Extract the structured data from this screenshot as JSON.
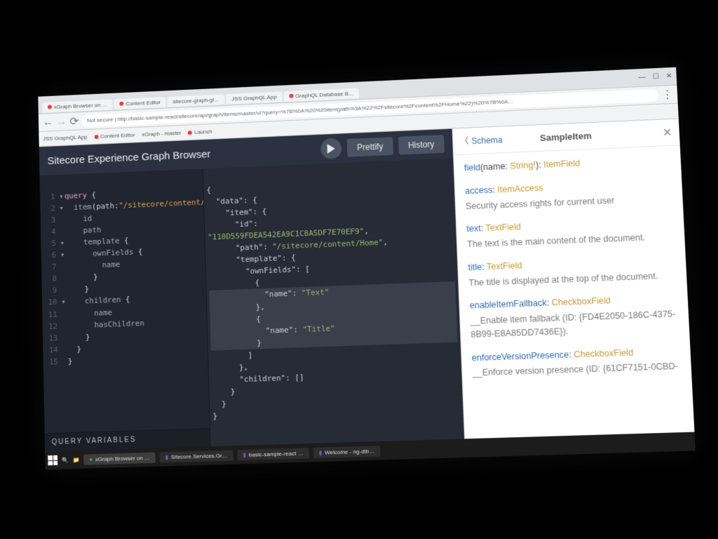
{
  "browser": {
    "tabs": [
      "xGraph Browser on …",
      "Content Editor",
      "sitecore-graph-gl…",
      "JSS GraphQL App",
      "GraphQL Database B…"
    ],
    "url": "Not secure | http://basic-sample-react/sitecore/api/graph/items/master/ui?query=%7B%0A%20%20item(path%3A%22%2Fsitecore%2Fcontent%2FHome%22)%20%7B%0A…",
    "bookmarks": [
      "JSS GraphQL App",
      "Content Editor",
      "xGraph - master",
      "Launch"
    ]
  },
  "toolbar": {
    "title": "Sitecore Experience Graph Browser",
    "prettify": "Prettify",
    "history": "History"
  },
  "queryLines": [
    {
      "n": "1",
      "tri": "▾",
      "t": "query {"
    },
    {
      "n": "2",
      "tri": "▾",
      "t": "  item(path:\"/sitecore/content/home\")"
    },
    {
      "n": "3",
      "tri": "",
      "t": "    id"
    },
    {
      "n": "4",
      "tri": "",
      "t": "    path"
    },
    {
      "n": "5",
      "tri": "▾",
      "t": "    template {"
    },
    {
      "n": "6",
      "tri": "▾",
      "t": "      ownFields {"
    },
    {
      "n": "7",
      "tri": "",
      "t": "        name"
    },
    {
      "n": "8",
      "tri": "",
      "t": "      }"
    },
    {
      "n": "9",
      "tri": "",
      "t": "    }"
    },
    {
      "n": "10",
      "tri": "▾",
      "t": "    children {"
    },
    {
      "n": "11",
      "tri": "",
      "t": "      name"
    },
    {
      "n": "12",
      "tri": "",
      "t": "      hasChildren"
    },
    {
      "n": "13",
      "tri": "",
      "t": "    }"
    },
    {
      "n": "14",
      "tri": "",
      "t": "  }"
    },
    {
      "n": "15",
      "tri": "",
      "t": "}"
    }
  ],
  "result": {
    "l1": "{",
    "l2": "  \"data\": {",
    "l3": "    \"item\": {",
    "l4": "      \"id\":",
    "id": "\"110D559FDEA542EA9C1C8A5DF7E70EF9\"",
    "l5": "      \"path\": ",
    "path": "\"/sitecore/content/Home\"",
    "l6": "      \"template\": {",
    "l7": "        \"ownFields\": [",
    "l8": "          {",
    "l9": "            \"name\": ",
    "v1": "\"Text\"",
    "l10": "          },",
    "l11": "          {",
    "l12": "            \"name\": ",
    "v2": "\"Title\"",
    "l13": "          }",
    "l14": "        ]",
    "l15": "      },",
    "l16": "      \"children\": []",
    "l17": "    }",
    "l18": "  }",
    "l19": "}"
  },
  "qvars": "QUERY VARIABLES",
  "docs": {
    "back": "Schema",
    "title": "SampleItem",
    "entries": [
      {
        "sig_pre": "field(name: ",
        "sig_arg": "String!",
        "sig_post": "): ",
        "type": "ItemField",
        "desc": ""
      },
      {
        "name": "access",
        "type": "ItemAccess",
        "desc": "Security access rights for current user"
      },
      {
        "name": "text",
        "type": "TextField",
        "desc": "The text is the main content of the document."
      },
      {
        "name": "title",
        "type": "TextField",
        "desc": "The title is displayed at the top of the document."
      },
      {
        "name": "enableItemFallback",
        "type": "CheckboxField",
        "desc": "__Enable item fallback (ID: {FD4E2050-186C-4375-8B99-E8A85DD7436E})."
      },
      {
        "name": "enforceVersionPresence",
        "type": "CheckboxField",
        "desc": "__Enforce version presence (ID: {61CF7151-0CBD-"
      }
    ]
  },
  "taskbar": {
    "items": [
      "xGraph Browser on …",
      "Sitecore.Services.Gr…",
      "basic-sample-react …",
      "Welcome - ng-dib…"
    ]
  }
}
